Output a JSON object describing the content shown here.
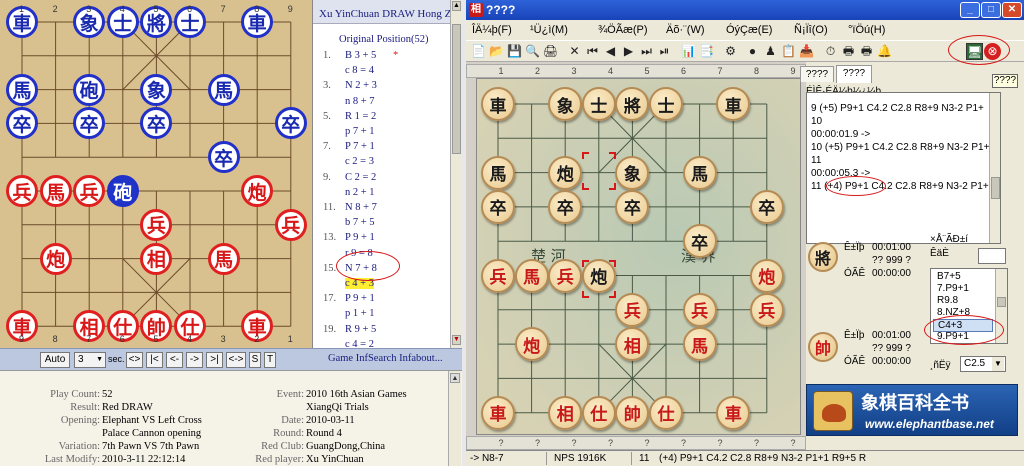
{
  "left_app": {
    "file_numbers_top": [
      "1",
      "2",
      "3",
      "4",
      "5",
      "6",
      "7",
      "8",
      "9"
    ],
    "file_numbers_bottom": [
      "9",
      "8",
      "7",
      "6",
      "5",
      "4",
      "3",
      "2",
      "1"
    ],
    "pieces": [
      {
        "ch": "車",
        "side": "blue",
        "f": 0,
        "r": 0
      },
      {
        "ch": "象",
        "side": "blue",
        "f": 2,
        "r": 0
      },
      {
        "ch": "士",
        "side": "blue",
        "f": 3,
        "r": 0
      },
      {
        "ch": "將",
        "side": "blue",
        "f": 4,
        "r": 0
      },
      {
        "ch": "士",
        "side": "blue",
        "f": 5,
        "r": 0
      },
      {
        "ch": "車",
        "side": "blue",
        "f": 7,
        "r": 0
      },
      {
        "ch": "馬",
        "side": "blue",
        "f": 0,
        "r": 2
      },
      {
        "ch": "砲",
        "side": "blue",
        "f": 2,
        "r": 2
      },
      {
        "ch": "象",
        "side": "blue",
        "f": 4,
        "r": 2
      },
      {
        "ch": "馬",
        "side": "blue",
        "f": 6,
        "r": 2
      },
      {
        "ch": "卒",
        "side": "blue",
        "f": 0,
        "r": 3
      },
      {
        "ch": "卒",
        "side": "blue",
        "f": 2,
        "r": 3
      },
      {
        "ch": "卒",
        "side": "blue",
        "f": 4,
        "r": 3
      },
      {
        "ch": "卒",
        "side": "blue",
        "f": 8,
        "r": 3
      },
      {
        "ch": "卒",
        "side": "blue",
        "f": 6,
        "r": 4
      },
      {
        "ch": "兵",
        "side": "red",
        "f": 0,
        "r": 5
      },
      {
        "ch": "馬",
        "side": "red",
        "f": 1,
        "r": 5
      },
      {
        "ch": "兵",
        "side": "red",
        "f": 2,
        "r": 5
      },
      {
        "ch": "砲",
        "side": "blue-fill",
        "f": 3,
        "r": 5
      },
      {
        "ch": "炮",
        "side": "red",
        "f": 7,
        "r": 5
      },
      {
        "ch": "兵",
        "side": "red",
        "f": 4,
        "r": 6
      },
      {
        "ch": "兵",
        "side": "red",
        "f": 8,
        "r": 6
      },
      {
        "ch": "炮",
        "side": "red",
        "f": 1,
        "r": 7
      },
      {
        "ch": "相",
        "side": "red",
        "f": 4,
        "r": 7
      },
      {
        "ch": "馬",
        "side": "red",
        "f": 6,
        "r": 7
      },
      {
        "ch": "車",
        "side": "red",
        "f": 0,
        "r": 9
      },
      {
        "ch": "相",
        "side": "red",
        "f": 2,
        "r": 9
      },
      {
        "ch": "仕",
        "side": "red",
        "f": 3,
        "r": 9
      },
      {
        "ch": "帥",
        "side": "red",
        "f": 4,
        "r": 9
      },
      {
        "ch": "仕",
        "side": "red",
        "f": 5,
        "r": 9
      },
      {
        "ch": "車",
        "side": "red",
        "f": 7,
        "r": 9
      }
    ],
    "moves_header": "Xu YinChuan DRAW Hong Zhi",
    "original_position": "Original Position(52)",
    "moves": [
      {
        "num": "1.",
        "text": "B 3 + 5",
        "mark": "*"
      },
      {
        "num": "",
        "text": "c 8 = 4"
      },
      {
        "num": "3.",
        "text": "N 2 + 3"
      },
      {
        "num": "",
        "text": "n 8 + 7"
      },
      {
        "num": "5.",
        "text": "R 1 = 2"
      },
      {
        "num": "",
        "text": "p 7 + 1"
      },
      {
        "num": "7.",
        "text": "P 7 + 1"
      },
      {
        "num": "",
        "text": "c 2 = 3"
      },
      {
        "num": "9.",
        "text": "C 2 = 2"
      },
      {
        "num": "",
        "text": "n 2 + 1"
      },
      {
        "num": "11.",
        "text": "N 8 + 7"
      },
      {
        "num": "",
        "text": "b 7 + 5"
      },
      {
        "num": "13.",
        "text": "P 9 + 1"
      },
      {
        "num": "",
        "text": "r 9 = 8"
      },
      {
        "num": "15.",
        "text": "N 7 + 8"
      },
      {
        "num": "",
        "text": "c 4 + 3",
        "highlight": true
      },
      {
        "num": "17.",
        "text": "P 9 + 1"
      },
      {
        "num": "",
        "text": "p 1 + 1"
      },
      {
        "num": "19.",
        "text": "R 9 + 5"
      },
      {
        "num": "",
        "text": "c 4 = 2"
      },
      {
        "num": "21.",
        "text": "C 2 = 1"
      }
    ],
    "controls": {
      "auto": "Auto",
      "speed": "3",
      "sec": "sec.",
      "b1": "<>",
      "b2": "|<",
      "b3": "<-",
      "b4": "->",
      "b5": ">|",
      "b6": "<->",
      "b7": "S",
      "b8": "T"
    },
    "status_text": "Game InfSearch Infabout...",
    "info_left": [
      {
        "k": "Play Count:",
        "v": "52"
      },
      {
        "k": "Result:",
        "v": "Red DRAW"
      },
      {
        "k": "Opening:",
        "v": "Elephant VS Left Cross"
      },
      {
        "k": "",
        "v": "Palace Cannon opening"
      },
      {
        "k": "Variation:",
        "v": "7th Pawn VS 7th Pawn"
      },
      {
        "k": "Last Modify:",
        "v": "2010-3-11 22:12:14"
      }
    ],
    "info_right": [
      {
        "k": "Event:",
        "v": "2010 16th Asian Games"
      },
      {
        "k": "",
        "v": "XiangQi Trials"
      },
      {
        "k": "Date:",
        "v": "2010-03-11"
      },
      {
        "k": "Round:",
        "v": "Round 4"
      },
      {
        "k": "Red Club:",
        "v": "GuangDong,China"
      },
      {
        "k": "Red player:",
        "v": "Xu YinChuan"
      }
    ]
  },
  "right_app": {
    "title": "????",
    "menu": [
      "ÎÄ¼þ(F)",
      "¹Ü¿ì(M)",
      "¾ÖÃæ(P)",
      "Äõ·¨(W)",
      "ÓýÇæ(E)",
      "Ñ¡Ïî(O)",
      "°ïÖú(H)"
    ],
    "ruler_top": [
      "1",
      "2",
      "3",
      "4",
      "5",
      "6",
      "7",
      "8",
      "9"
    ],
    "ruler_bottom": [
      "?",
      "?",
      "?",
      "?",
      "?",
      "?",
      "?",
      "?",
      "?"
    ],
    "river_left": "楚  河",
    "river_right": "漢  界",
    "pieces": [
      {
        "ch": "車",
        "side": "b",
        "f": 0,
        "r": 0
      },
      {
        "ch": "象",
        "side": "b",
        "f": 2,
        "r": 0
      },
      {
        "ch": "士",
        "side": "b",
        "f": 3,
        "r": 0
      },
      {
        "ch": "將",
        "side": "b",
        "f": 4,
        "r": 0
      },
      {
        "ch": "士",
        "side": "b",
        "f": 5,
        "r": 0
      },
      {
        "ch": "車",
        "side": "b",
        "f": 7,
        "r": 0
      },
      {
        "ch": "馬",
        "side": "b",
        "f": 0,
        "r": 2
      },
      {
        "ch": "炮",
        "side": "b",
        "f": 2,
        "r": 2
      },
      {
        "ch": "象",
        "side": "b",
        "f": 4,
        "r": 2
      },
      {
        "ch": "馬",
        "side": "b",
        "f": 6,
        "r": 2
      },
      {
        "ch": "卒",
        "side": "b",
        "f": 0,
        "r": 3
      },
      {
        "ch": "卒",
        "side": "b",
        "f": 2,
        "r": 3
      },
      {
        "ch": "卒",
        "side": "b",
        "f": 4,
        "r": 3
      },
      {
        "ch": "卒",
        "side": "b",
        "f": 8,
        "r": 3
      },
      {
        "ch": "卒",
        "side": "b",
        "f": 6,
        "r": 4
      },
      {
        "ch": "兵",
        "side": "r",
        "f": 0,
        "r": 5
      },
      {
        "ch": "馬",
        "side": "r",
        "f": 1,
        "r": 5
      },
      {
        "ch": "兵",
        "side": "r",
        "f": 2,
        "r": 5
      },
      {
        "ch": "炮",
        "side": "b",
        "f": 3,
        "r": 5
      },
      {
        "ch": "炮",
        "side": "r",
        "f": 8,
        "r": 5
      },
      {
        "ch": "兵",
        "side": "r",
        "f": 4,
        "r": 6
      },
      {
        "ch": "兵",
        "side": "r",
        "f": 6,
        "r": 6
      },
      {
        "ch": "兵",
        "side": "r",
        "f": 8,
        "r": 6
      },
      {
        "ch": "炮",
        "side": "r",
        "f": 1,
        "r": 7
      },
      {
        "ch": "相",
        "side": "r",
        "f": 4,
        "r": 7
      },
      {
        "ch": "馬",
        "side": "r",
        "f": 6,
        "r": 7
      },
      {
        "ch": "車",
        "side": "r",
        "f": 0,
        "r": 9
      },
      {
        "ch": "相",
        "side": "r",
        "f": 2,
        "r": 9
      },
      {
        "ch": "仕",
        "side": "r",
        "f": 3,
        "r": 9
      },
      {
        "ch": "帥",
        "side": "r",
        "f": 4,
        "r": 9
      },
      {
        "ch": "仕",
        "side": "r",
        "f": 5,
        "r": 9
      },
      {
        "ch": "車",
        "side": "r",
        "f": 7,
        "r": 9
      }
    ],
    "tabs": [
      "????",
      "????"
    ],
    "tab_extra": "????",
    "log_header": "ÉÌÊ·ÉÄ¼þ¼¿¼þ",
    "log_lines": [
      "9   (+5) P9+1 C4.2 C2.8 R8+9 N3-2 P1+",
      "10",
      "00:00:01.9 ->",
      "10   (+5) P9+1 C4.2 C2.8 R8+9 N3-2 P1+",
      "11",
      "00:00:05.3 ->",
      "11   (+4) P9+1 C4.2 C2.8 R8+9 N3-2 P1+"
    ],
    "top_piece": "將",
    "bottom_piece": "帥",
    "top_clock": {
      "l1": "Ê±Ïþ",
      "t1": "00:01:00",
      "l2": "?? 999 ?",
      "l3": "ÓÃÊ",
      "t3": "00:00:00"
    },
    "bottom_clock": {
      "l1": "Ê±Ïþ",
      "t1": "00:01:00",
      "l2": "?? 999 ?",
      "l3": "ÓÃÊ",
      "t3": "00:00:00"
    },
    "side_label_1": "×Å¨ÃÐ±í",
    "side_label_2": "ÊäÈ",
    "move_list": [
      "B7+5",
      "7.P9+1",
      "R9.8",
      "8.NZ+8",
      "C4+3",
      "9.P9+1"
    ],
    "move_list_selected": 4,
    "engine_label": "¸ñËÿ",
    "engine_value": "C2.5",
    "ad_title": "象棋百科全书",
    "ad_url": "www.elephantbase.net",
    "status": [
      "-> N8-7",
      "NPS 1916K",
      "11",
      "(+4) P9+1 C4.2 C2.8 R8+9 N3-2 P1+1 R9+5 R"
    ]
  }
}
